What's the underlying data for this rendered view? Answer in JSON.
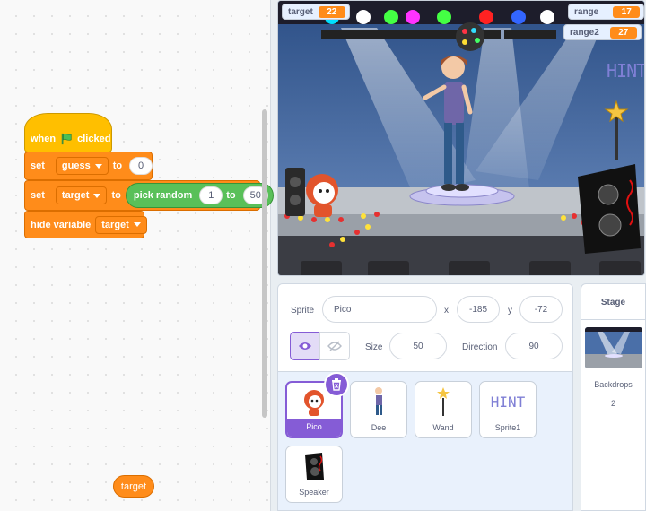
{
  "script": {
    "hat": {
      "when": "when",
      "clicked": "clicked"
    },
    "set1": {
      "set": "set",
      "var": "guess",
      "to": "to",
      "value": "0"
    },
    "set2": {
      "set": "set",
      "var": "target",
      "to": "to",
      "op": "pick random",
      "from": "1",
      "op_to": "to",
      "max": "50"
    },
    "hide": {
      "label": "hide variable",
      "var": "target"
    },
    "floating_reporter": "target"
  },
  "stage": {
    "monitors": [
      {
        "label": "target",
        "value": "22"
      },
      {
        "label": "range",
        "value": "17"
      },
      {
        "label": "range2",
        "value": "27"
      }
    ],
    "hint_text": "HINT"
  },
  "sprite_info": {
    "sprite_label": "Sprite",
    "sprite_name": "Pico",
    "x_label": "x",
    "x": "-185",
    "y_label": "y",
    "y": "-72",
    "size_label": "Size",
    "size": "50",
    "direction_label": "Direction",
    "direction": "90"
  },
  "sprites": [
    {
      "name": "Pico",
      "selected": true
    },
    {
      "name": "Dee"
    },
    {
      "name": "Wand"
    },
    {
      "name": "Sprite1",
      "thumb_text": "HINT"
    },
    {
      "name": "Speaker"
    }
  ],
  "stage_pane": {
    "title": "Stage",
    "backdrops_label": "Backdrops",
    "backdrops_count": "2"
  },
  "colors": {
    "events": "#ffbf00",
    "variables": "#ff8c1a",
    "operators": "#59c059",
    "selection": "#855cd6"
  }
}
